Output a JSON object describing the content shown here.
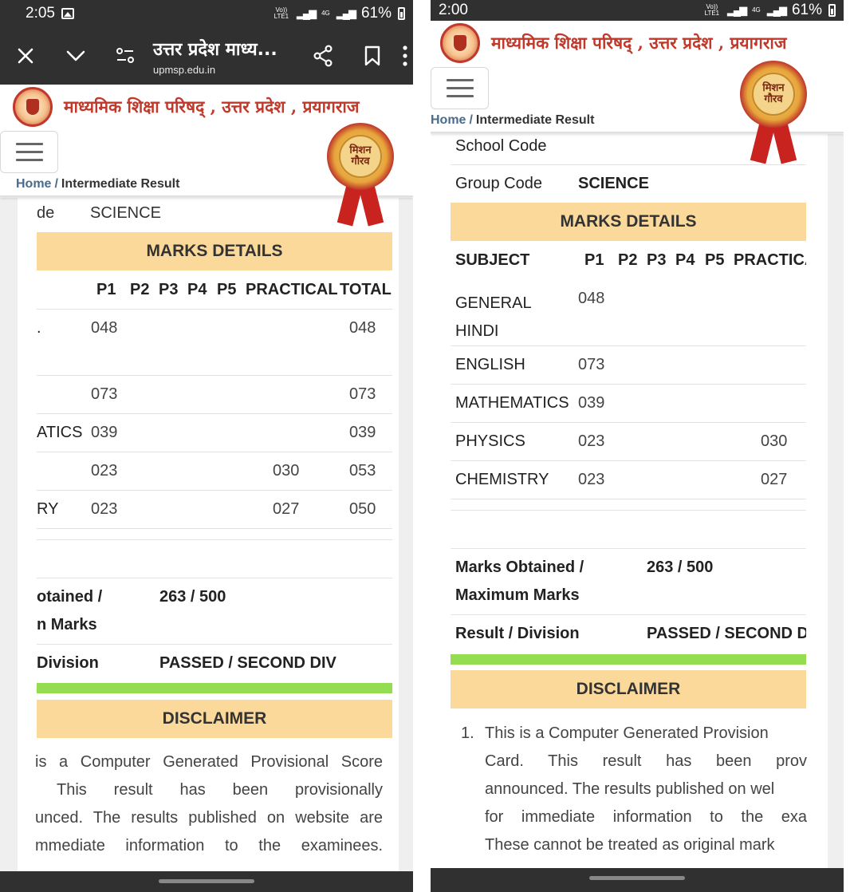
{
  "left": {
    "status": {
      "time": "2:05",
      "volte": "Vo)) LTE1",
      "network": "4G",
      "battery": "61%"
    },
    "browser": {
      "title": "उत्तर प्रदेश माध्य...",
      "url": "upmsp.edu.in"
    },
    "site": {
      "name": "माध्यमिक शिक्षा परिषद् , उत्तर प्रदेश , प्रयागराज",
      "badge": "मिशन गौरव"
    },
    "breadcrumb": {
      "home": "Home",
      "sep": "/",
      "current": "Intermediate Result"
    },
    "group_row": {
      "label": "de",
      "value": "SCIENCE"
    },
    "marks_header": "MARKS DETAILS",
    "columns": [
      "P1",
      "P2",
      "P3",
      "P4",
      "P5",
      "PRACTICAL",
      "TOTAL"
    ],
    "rows": [
      {
        "subject": ".",
        "p1": "048",
        "practical": "",
        "total": "048"
      },
      {
        "subject": "",
        "p1": "073",
        "practical": "",
        "total": "073"
      },
      {
        "subject": "ATICS",
        "p1": "039",
        "practical": "",
        "total": "039"
      },
      {
        "subject": "",
        "p1": "023",
        "practical": "030",
        "total": "053"
      },
      {
        "subject": "RY",
        "p1": "023",
        "practical": "027",
        "total": "050"
      }
    ],
    "marks_obtained": {
      "label_line1": "otained /",
      "label_line2": "n Marks",
      "value": "263 / 500"
    },
    "result": {
      "label": "Division",
      "value": "PASSED / SECOND DIV"
    },
    "disclaimer_header": "DISCLAIMER",
    "disclaimer_lines": [
      "is a Computer Generated Provisional Score",
      "This result has been provisionally",
      "unced. The results published on website are",
      "mmediate information to the examinees."
    ]
  },
  "right": {
    "status": {
      "time": "2:00",
      "volte": "Vo)) LTE1",
      "network": "4G",
      "battery": "61%"
    },
    "site": {
      "name": "माध्यमिक शिक्षा परिषद् , उत्तर प्रदेश , प्रयागराज",
      "badge": "मिशन गौरव"
    },
    "breadcrumb": {
      "home": "Home",
      "sep": "/",
      "current": "Intermediate Result"
    },
    "school_row": {
      "label": "School Code",
      "value": ""
    },
    "group_row": {
      "label": "Group Code",
      "value": "SCIENCE"
    },
    "marks_header": "MARKS DETAILS",
    "columns": [
      "SUBJECT",
      "P1",
      "P2",
      "P3",
      "P4",
      "P5",
      "PRACTICA"
    ],
    "rows": [
      {
        "subject": "GENERAL HINDI",
        "p1": "048",
        "practical": ""
      },
      {
        "subject": "ENGLISH",
        "p1": "073",
        "practical": ""
      },
      {
        "subject": "MATHEMATICS",
        "p1": "039",
        "practical": ""
      },
      {
        "subject": "PHYSICS",
        "p1": "023",
        "practical": "030"
      },
      {
        "subject": "CHEMISTRY",
        "p1": "023",
        "practical": "027"
      }
    ],
    "marks_obtained": {
      "label_line1": "Marks Obtained /",
      "label_line2": "Maximum Marks",
      "value": "263 / 500"
    },
    "result": {
      "label": "Result / Division",
      "value": "PASSED / SECOND DI"
    },
    "disclaimer_header": "DISCLAIMER",
    "disclaimer_item_number": "1.",
    "disclaimer_lines": [
      "This is a Computer Generated Provision",
      "Card. This result has been prov",
      "announced. The results published on wel",
      "for immediate information to the exa",
      "These cannot be treated as original mark"
    ]
  }
}
